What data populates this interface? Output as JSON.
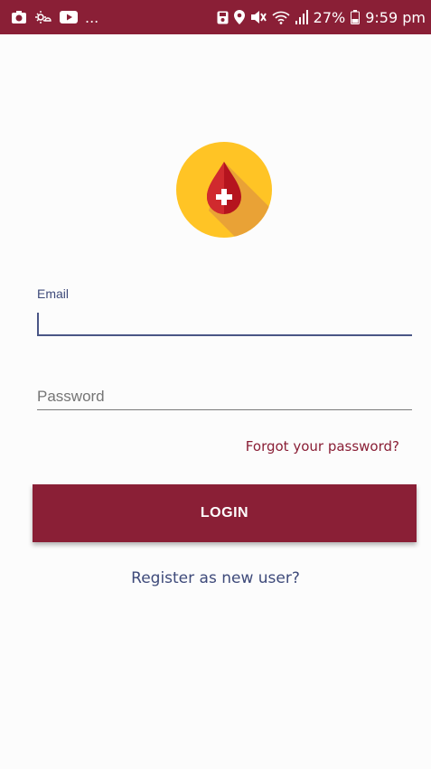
{
  "status_bar": {
    "left_icons": [
      "photo-icon",
      "weather-icon",
      "youtube-icon"
    ],
    "left_more": "...",
    "right_icons": [
      "save-icon",
      "location-icon",
      "mute-icon",
      "wifi-icon",
      "signal-icon"
    ],
    "battery_percent": "27%",
    "time": "9:59 pm",
    "background_color": "#8a1f36"
  },
  "logo": {
    "icon": "blood-drop-icon",
    "circle_color": "#ffc425",
    "drop_color": "#b5141e"
  },
  "form": {
    "email_label": "Email",
    "email_value": "",
    "password_placeholder": "Password",
    "password_value": "",
    "forgot_password_text": "Forgot your password?",
    "login_label": "LOGIN",
    "register_text": "Register as new user?"
  },
  "colors": {
    "accent": "#8a1f36",
    "secondary": "#3e4a7a"
  }
}
